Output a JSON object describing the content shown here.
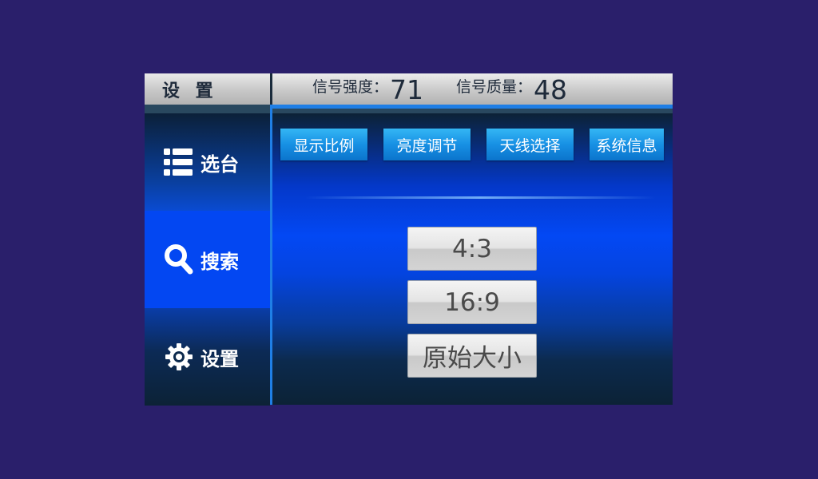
{
  "header": {
    "title": "设 置",
    "signal_strength_label": "信号强度：",
    "signal_strength_value": "71",
    "signal_quality_label": "信号质量：",
    "signal_quality_value": "48"
  },
  "sidebar": {
    "items": [
      {
        "label": "选台",
        "icon": "list-icon",
        "active": false
      },
      {
        "label": "搜索",
        "icon": "search-icon",
        "active": true
      },
      {
        "label": "设置",
        "icon": "gear-icon",
        "active": false
      }
    ]
  },
  "tabs": [
    {
      "label": "显示比例"
    },
    {
      "label": "亮度调节"
    },
    {
      "label": "天线选择"
    },
    {
      "label": "系统信息"
    }
  ],
  "options": [
    {
      "label": "4:3"
    },
    {
      "label": "16:9"
    },
    {
      "label": "原始大小"
    }
  ],
  "colors": {
    "background": "#2a1f6b",
    "accent_blue": "#1f7fe6",
    "active_item": "#0347f2",
    "tab_blue": "#1790e4"
  }
}
